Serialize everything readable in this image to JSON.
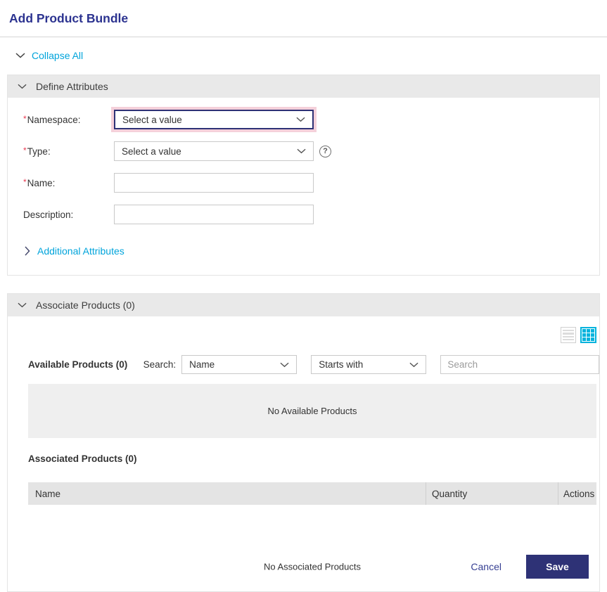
{
  "page": {
    "title": "Add Product Bundle",
    "collapse_all_label": "Collapse All"
  },
  "define_attributes": {
    "title": "Define Attributes",
    "namespace": {
      "required_marker": "*",
      "label": "Namespace:",
      "value": "Select a value"
    },
    "type": {
      "required_marker": "*",
      "label": "Type:",
      "value": "Select a value"
    },
    "name": {
      "required_marker": "*",
      "label": "Name:",
      "value": ""
    },
    "description": {
      "label": "Description:",
      "value": ""
    },
    "additional_attributes_label": "Additional Attributes"
  },
  "associate_products": {
    "title": "Associate Products (0)",
    "available_title": "Available Products (0)",
    "search_label": "Search:",
    "search_field_value": "Name",
    "search_operator_value": "Starts with",
    "search_placeholder": "Search",
    "available_empty_text": "No Available Products",
    "associated_title": "Associated Products (0)",
    "columns": [
      "Name",
      "Quantity",
      "Actions"
    ],
    "associated_empty_text": "No Associated Products"
  },
  "footer": {
    "cancel_label": "Cancel",
    "save_label": "Save"
  },
  "icons": {
    "help_glyph": "?"
  },
  "colors": {
    "title_navy": "#2c3390",
    "accent_navy": "#2e3276",
    "link_teal": "#00a4db",
    "grid_icon_cyan": "#00b3dd",
    "required_red": "#e8384f",
    "focus_halo_pink": "#f4d0da",
    "section_header_gray": "#e9e9e9",
    "table_header_gray": "#e4e4e4",
    "empty_box_gray": "#efefef"
  }
}
